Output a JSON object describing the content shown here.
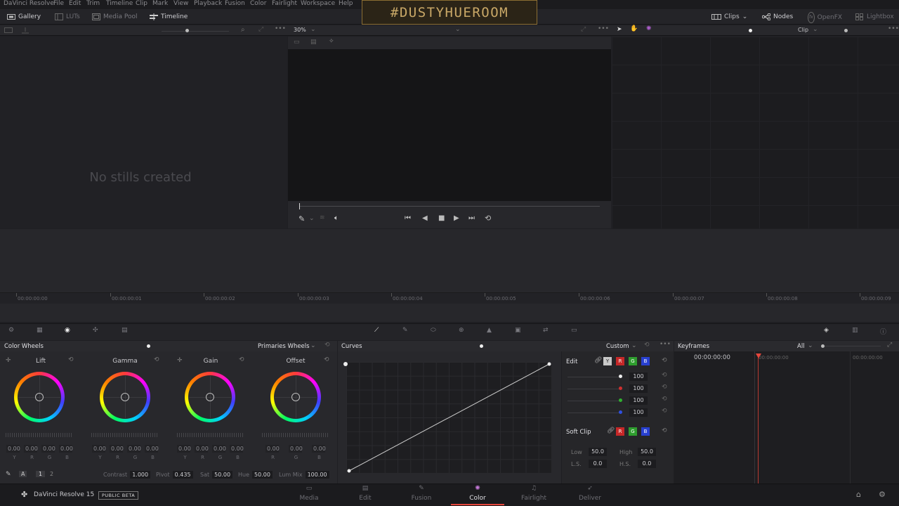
{
  "menubar": {
    "app": "DaVinci Resolve",
    "items": [
      "File",
      "Edit",
      "Trim",
      "Timeline",
      "Clip",
      "Mark",
      "View",
      "Playback",
      "Fusion",
      "Color",
      "Fairlight",
      "Workspace",
      "Help"
    ]
  },
  "banner": {
    "text": "#DUSTYHUEROOM"
  },
  "toolbar": {
    "gallery": "Gallery",
    "luts": "LUTs",
    "media_pool": "Media Pool",
    "timeline": "Timeline",
    "clips": "Clips",
    "nodes": "Nodes",
    "openfx": "OpenFX",
    "lightbox": "Lightbox"
  },
  "subbar": {
    "zoom": "30%",
    "clip": "Clip"
  },
  "gallery": {
    "empty_text": "No stills created"
  },
  "ruler": {
    "timecodes": [
      "00:00:00:00",
      "00:00:00:01",
      "00:00:00:02",
      "00:00:00:03",
      "00:00:00:04",
      "00:00:00:05",
      "00:00:00:06",
      "00:00:00:07",
      "00:00:00:08",
      "00:00:00:09"
    ]
  },
  "color_wheels": {
    "title": "Color Wheels",
    "mode": "Primaries Wheels",
    "wheels": [
      {
        "label": "Lift",
        "values": [
          "0.00",
          "0.00",
          "0.00",
          "0.00"
        ],
        "channels": [
          "Y",
          "R",
          "G",
          "B"
        ]
      },
      {
        "label": "Gamma",
        "values": [
          "0.00",
          "0.00",
          "0.00",
          "0.00"
        ],
        "channels": [
          "Y",
          "R",
          "G",
          "B"
        ]
      },
      {
        "label": "Gain",
        "values": [
          "0.00",
          "0.00",
          "0.00",
          "0.00"
        ],
        "channels": [
          "Y",
          "R",
          "G",
          "B"
        ]
      },
      {
        "label": "Offset",
        "values": [
          "0.00",
          "0.00",
          "0.00"
        ],
        "channels": [
          "R",
          "G",
          "B"
        ]
      }
    ],
    "page_a": "A",
    "page_1": "1",
    "page_2": "2",
    "contrast_label": "Contrast",
    "contrast": "1.000",
    "pivot_label": "Pivot",
    "pivot": "0.435",
    "sat_label": "Sat",
    "sat": "50.00",
    "hue_label": "Hue",
    "hue": "50.00",
    "lummix_label": "Lum Mix",
    "lummix": "100.00"
  },
  "curves": {
    "title": "Curves",
    "mode": "Custom",
    "edit_label": "Edit",
    "y_label": "Y",
    "r_label": "R",
    "g_label": "G",
    "b_label": "B",
    "intensities": [
      "100",
      "100",
      "100",
      "100"
    ],
    "softclip_label": "Soft Clip",
    "low_label": "Low",
    "low": "50.0",
    "high_label": "High",
    "high": "50.0",
    "ls_label": "L.S.",
    "ls": "0.0",
    "hs_label": "H.S.",
    "hs": "0.0"
  },
  "keyframes": {
    "title": "Keyframes",
    "filter": "All",
    "timecode": "00:00:00:00",
    "tc_a": "00:00:00:00",
    "tc_b": "00:00:00:00"
  },
  "footer": {
    "app_name": "DaVinci Resolve 15",
    "badge": "PUBLIC BETA",
    "tabs": [
      "Media",
      "Edit",
      "Fusion",
      "Color",
      "Fairlight",
      "Deliver"
    ],
    "active_tab": "Color"
  },
  "colors": {
    "accent": "#e6463c",
    "banner_gold": "#c9a867"
  }
}
